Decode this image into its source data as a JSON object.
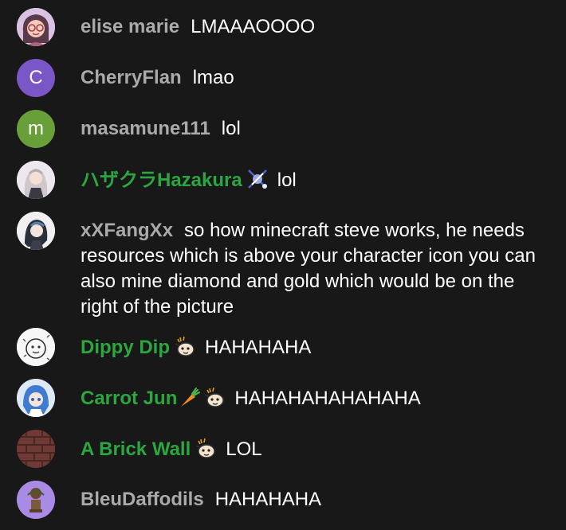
{
  "messages": [
    {
      "author": "elise marie",
      "text": "LMAAAOOOO",
      "member": false,
      "avatar": {
        "type": "image",
        "desc": "illustrated-girl-glasses",
        "color": "#c9a8d6"
      }
    },
    {
      "author": "CherryFlan",
      "text": "lmao",
      "member": false,
      "avatar": {
        "type": "letter",
        "letter": "C",
        "color": "#7b56c7"
      }
    },
    {
      "author": "masamune111",
      "text": "lol",
      "member": false,
      "avatar": {
        "type": "letter",
        "letter": "m",
        "color": "#689f38"
      }
    },
    {
      "author": "ハザクラHazakura",
      "text": "lol",
      "member": true,
      "badges": [
        "member-badge-icon"
      ],
      "avatar": {
        "type": "image",
        "desc": "anime-girl-white-hair",
        "color": "#d9d2d8"
      }
    },
    {
      "author": "xXFangXx",
      "text": "so how minecraft steve works, he needs resources which is above your character icon you can also mine diamond and gold which would be on the right of the picture",
      "member": false,
      "avatar": {
        "type": "image",
        "desc": "anime-character-dark-hair",
        "color": "#e8e8ec"
      }
    },
    {
      "author": "Dippy Dip",
      "text": "HAHAHAHA",
      "member": true,
      "badges": [
        "member-emoji-icon"
      ],
      "avatar": {
        "type": "image",
        "desc": "doodle-character",
        "color": "#f2f2f2"
      }
    },
    {
      "author": "Carrot Jun",
      "text": "HAHAHAHAHAHAHA",
      "member": true,
      "badges": [
        "carrot-icon",
        "member-emoji-icon"
      ],
      "avatar": {
        "type": "image",
        "desc": "anime-blue-hair",
        "color": "#5b8bd6"
      }
    },
    {
      "author": "A Brick Wall",
      "text": "LOL",
      "member": true,
      "badges": [
        "member-emoji-icon"
      ],
      "avatar": {
        "type": "image",
        "desc": "brick-wall",
        "color": "#7a3c36"
      }
    },
    {
      "author": "BleuDaffodils",
      "text": "HAHAHAHA",
      "member": false,
      "avatar": {
        "type": "image",
        "desc": "purple-flower-pot",
        "color": "#8f6fd9"
      }
    }
  ],
  "colors": {
    "background": "#181818",
    "author_default": "#aaaaaa",
    "author_member": "#2ba640",
    "message_text": "#ffffff"
  }
}
